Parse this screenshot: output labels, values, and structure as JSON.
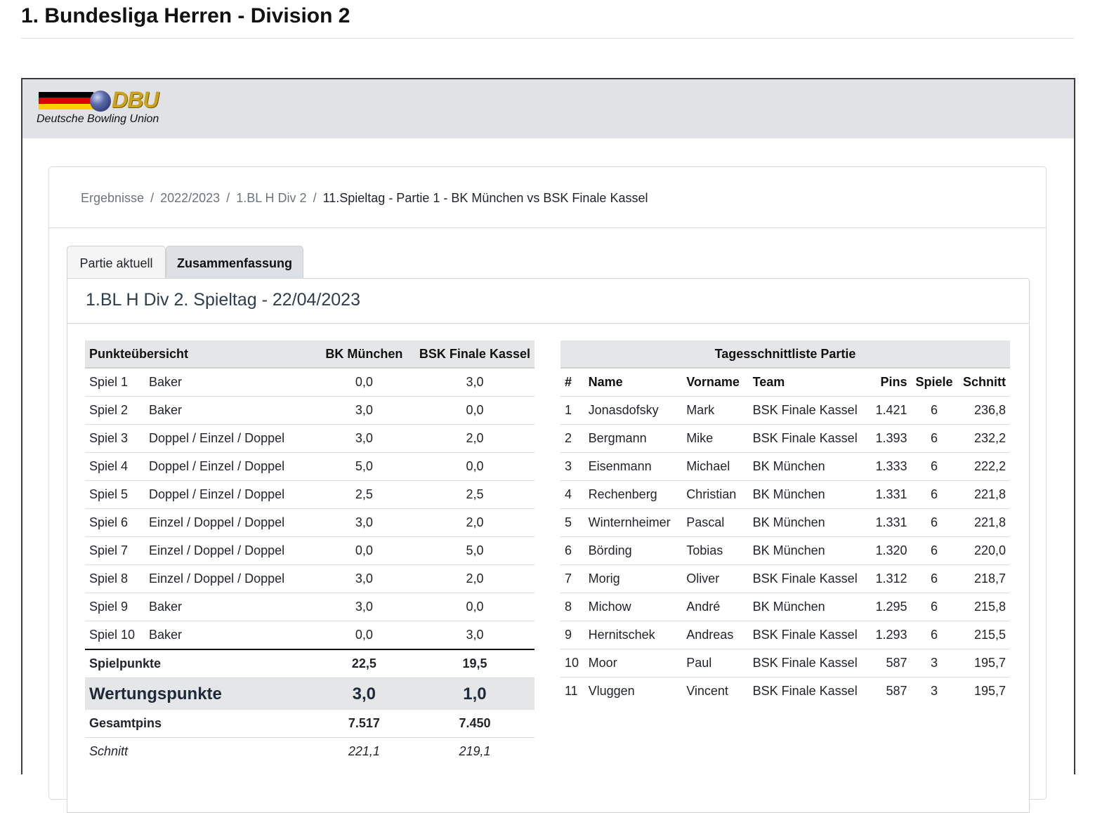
{
  "page_title": "1. Bundesliga Herren - Division 2",
  "logo": {
    "mark": "DBU",
    "text": "Deutsche Bowling Union",
    "flag_colors": [
      "#000000",
      "#dd0000",
      "#ffce00"
    ]
  },
  "breadcrumb": [
    "Ergebnisse",
    "2022/2023",
    "1.BL H Div 2",
    "11.Spieltag - Partie 1 - BK München vs BSK Finale Kassel"
  ],
  "tabs": [
    "Partie aktuell",
    "Zusammenfassung"
  ],
  "active_tab": "Zusammenfassung",
  "panel_title": "1.BL H Div 2. Spieltag - 22/04/2023",
  "punkte": {
    "headers": [
      "Punkteübersicht",
      "BK München",
      "BSK Finale Kassel"
    ],
    "games": [
      {
        "spiel": "Spiel 1",
        "typ": "Baker",
        "a": "0,0",
        "b": "3,0"
      },
      {
        "spiel": "Spiel 2",
        "typ": "Baker",
        "a": "3,0",
        "b": "0,0"
      },
      {
        "spiel": "Spiel 3",
        "typ": "Doppel / Einzel / Doppel",
        "a": "3,0",
        "b": "2,0"
      },
      {
        "spiel": "Spiel 4",
        "typ": "Doppel / Einzel / Doppel",
        "a": "5,0",
        "b": "0,0"
      },
      {
        "spiel": "Spiel 5",
        "typ": "Doppel / Einzel / Doppel",
        "a": "2,5",
        "b": "2,5"
      },
      {
        "spiel": "Spiel 6",
        "typ": "Einzel / Doppel / Doppel",
        "a": "3,0",
        "b": "2,0"
      },
      {
        "spiel": "Spiel 7",
        "typ": "Einzel / Doppel / Doppel",
        "a": "0,0",
        "b": "5,0"
      },
      {
        "spiel": "Spiel 8",
        "typ": "Einzel / Doppel / Doppel",
        "a": "3,0",
        "b": "2,0"
      },
      {
        "spiel": "Spiel 9",
        "typ": "Baker",
        "a": "3,0",
        "b": "0,0"
      },
      {
        "spiel": "Spiel 10",
        "typ": "Baker",
        "a": "0,0",
        "b": "3,0"
      }
    ],
    "spielpunkte": {
      "label": "Spielpunkte",
      "a": "22,5",
      "b": "19,5"
    },
    "wertungspunkte": {
      "label": "Wertungspunkte",
      "a": "3,0",
      "b": "1,0"
    },
    "gesamtpins": {
      "label": "Gesamtpins",
      "a": "7.517",
      "b": "7.450"
    },
    "schnitt": {
      "label": "Schnitt",
      "a": "221,1",
      "b": "219,1"
    }
  },
  "tages": {
    "title": "Tagesschnittliste Partie",
    "headers": [
      "#",
      "Name",
      "Vorname",
      "Team",
      "Pins",
      "Spiele",
      "Schnitt"
    ],
    "rows": [
      [
        "1",
        "Jonasdofsky",
        "Mark",
        "BSK Finale Kassel",
        "1.421",
        "6",
        "236,8"
      ],
      [
        "2",
        "Bergmann",
        "Mike",
        "BSK Finale Kassel",
        "1.393",
        "6",
        "232,2"
      ],
      [
        "3",
        "Eisenmann",
        "Michael",
        "BK München",
        "1.333",
        "6",
        "222,2"
      ],
      [
        "4",
        "Rechenberg",
        "Christian",
        "BK München",
        "1.331",
        "6",
        "221,8"
      ],
      [
        "5",
        "Winternheimer",
        "Pascal",
        "BK München",
        "1.331",
        "6",
        "221,8"
      ],
      [
        "6",
        "Börding",
        "Tobias",
        "BK München",
        "1.320",
        "6",
        "220,0"
      ],
      [
        "7",
        "Morig",
        "Oliver",
        "BSK Finale Kassel",
        "1.312",
        "6",
        "218,7"
      ],
      [
        "8",
        "Michow",
        "André",
        "BK München",
        "1.295",
        "6",
        "215,8"
      ],
      [
        "9",
        "Hernitschek",
        "Andreas",
        "BSK Finale Kassel",
        "1.293",
        "6",
        "215,5"
      ],
      [
        "10",
        "Moor",
        "Paul",
        "BSK Finale Kassel",
        "587",
        "3",
        "195,7"
      ],
      [
        "11",
        "Vluggen",
        "Vincent",
        "BSK Finale Kassel",
        "587",
        "3",
        "195,7"
      ]
    ]
  }
}
